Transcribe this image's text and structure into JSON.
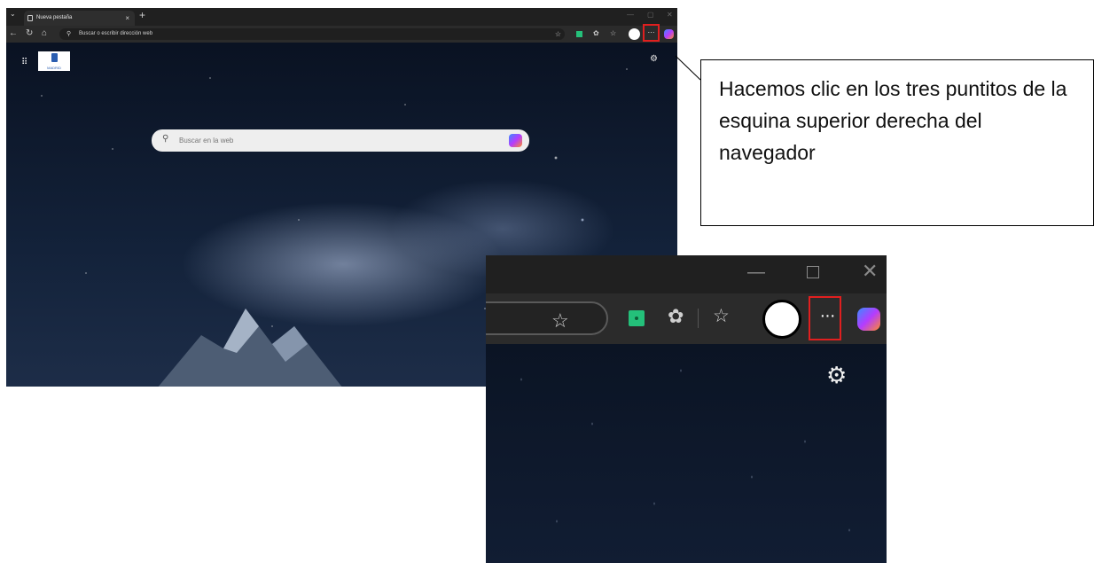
{
  "browser": {
    "tab_title": "Nueva pestaña",
    "tab_close": "×",
    "new_tab": "+",
    "address_placeholder": "Buscar o escribir dirección web",
    "search_placeholder": "Buscar en la web",
    "logo_text": "MADRID",
    "more_button": "···"
  },
  "callout": {
    "text": "Hacemos clic en los tres puntitos de la esquina superior derecha del navegador"
  },
  "zoom": {
    "more_button": "···"
  },
  "colors": {
    "highlight": "#e01f1f",
    "extension_green": "#24c07a"
  },
  "icons": [
    "chevron-down-icon",
    "tab-page-icon",
    "back-icon",
    "refresh-icon",
    "home-icon",
    "search-icon",
    "star-icon",
    "extension-icon",
    "puzzle-icon",
    "favorites-icon",
    "profile-avatar",
    "more-icon",
    "copilot-icon",
    "apps-grid-icon",
    "settings-icon",
    "minimize-icon",
    "maximize-icon",
    "close-icon"
  ]
}
